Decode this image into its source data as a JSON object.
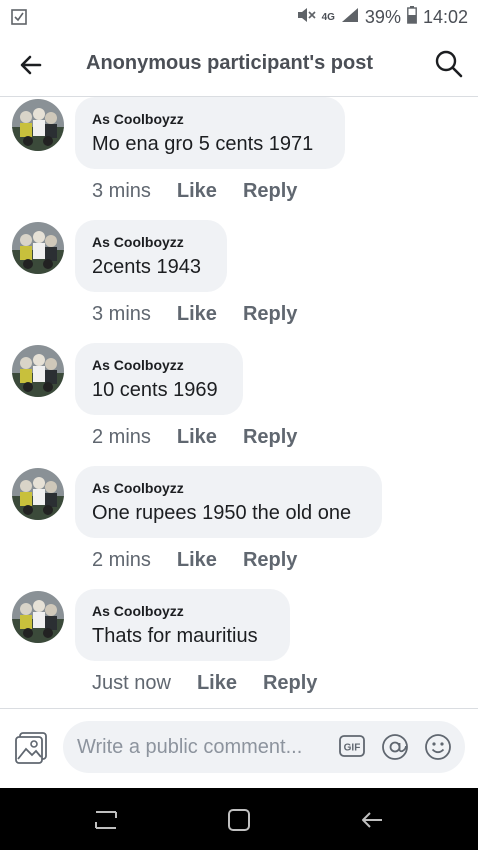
{
  "status_bar": {
    "network_label": "4G",
    "battery": "39%",
    "time": "14:02"
  },
  "header": {
    "title": "Anonymous participant's post"
  },
  "comments": [
    {
      "author": "As Coolboyzz",
      "text": "Mo ena gro 5 cents 1971",
      "time": "3 mins",
      "like_label": "Like",
      "reply_label": "Reply"
    },
    {
      "author": "As Coolboyzz",
      "text": "2cents 1943",
      "time": "3 mins",
      "like_label": "Like",
      "reply_label": "Reply"
    },
    {
      "author": "As Coolboyzz",
      "text": "10 cents 1969",
      "time": "2 mins",
      "like_label": "Like",
      "reply_label": "Reply"
    },
    {
      "author": "As Coolboyzz",
      "text": "One rupees 1950 the old one",
      "time": "2 mins",
      "like_label": "Like",
      "reply_label": "Reply"
    },
    {
      "author": "As Coolboyzz",
      "text": "Thats for mauritius",
      "time": "Just now",
      "like_label": "Like",
      "reply_label": "Reply"
    }
  ],
  "composer": {
    "placeholder": "Write a public comment...",
    "gif_label": "GIF"
  },
  "colors": {
    "bubble": "#f0f2f5",
    "text": "#1c1e21",
    "muted": "#606770",
    "header_text": "#4b4f56"
  }
}
